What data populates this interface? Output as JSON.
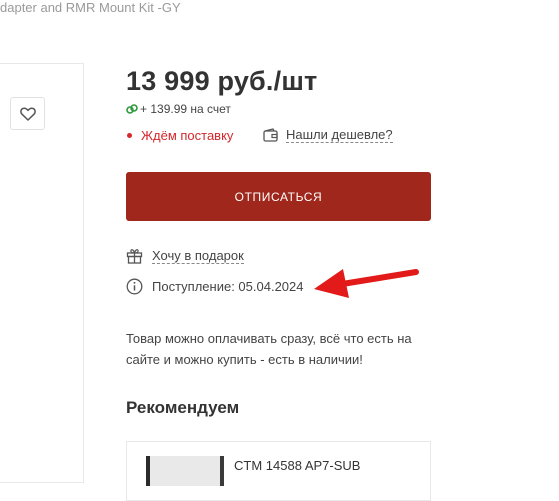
{
  "product": {
    "title_fragment": "dapter and RMR Mount Kit -GY",
    "price": "13 999 руб./шт",
    "bonus": "+ 139.99 на счет",
    "stock_status": "Ждём поставку",
    "cheaper_link": "Нашли дешевле?",
    "unsubscribe_button": "ОТПИСАТЬСЯ",
    "gift_link": "Хочу в подарок",
    "arrival": "Поступление: 05.04.2024",
    "description": "Товар можно оплачивать сразу, всё что есть на сайте и можно купить - есть в наличии!"
  },
  "recommended": {
    "heading": "Рекомендуем",
    "items": [
      {
        "name": "CTM 14588 AP7-SUB"
      }
    ]
  },
  "colors": {
    "accent": "#a0271b",
    "status": "#d6272a",
    "bonus_icon": "#2e9a3b",
    "annotation_arrow": "#e21a1a"
  },
  "icons": {
    "favorite": "heart-icon",
    "bonus": "coin-icon",
    "cheaper": "wallet-icon",
    "gift": "gift-icon",
    "info": "info-icon"
  }
}
